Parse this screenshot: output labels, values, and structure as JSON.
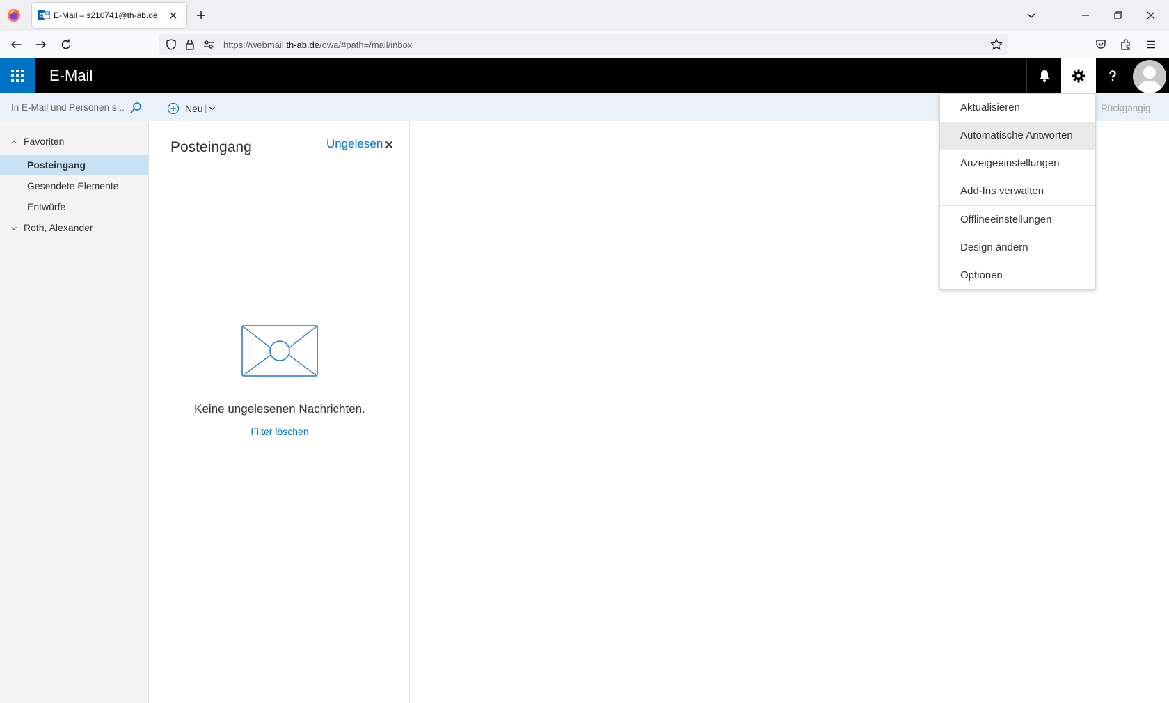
{
  "browser": {
    "tab_title": "E-Mail – s210741@th-ab.de",
    "url_prefix": "https://webmail.",
    "url_domain": "th-ab.de",
    "url_path": "/owa/#path=/mail/inbox"
  },
  "header": {
    "app_title": "E-Mail"
  },
  "search": {
    "placeholder": "In E-Mail und Personen s..."
  },
  "commands": {
    "new_label": "Neu",
    "undo_label": "Rückgängig"
  },
  "nav": {
    "favorites_label": "Favoriten",
    "items": [
      {
        "label": "Posteingang"
      },
      {
        "label": "Gesendete Elemente"
      },
      {
        "label": "Entwürfe"
      }
    ],
    "account_label": "Roth, Alexander"
  },
  "list": {
    "folder_title": "Posteingang",
    "filter_label": "Ungelesen",
    "empty_text": "Keine ungelesenen Nachrichten.",
    "clear_filter": "Filter löschen"
  },
  "settings_menu": {
    "items": [
      {
        "label": "Aktualisieren"
      },
      {
        "label": "Automatische Antworten"
      },
      {
        "label": "Anzeigeeinstellungen"
      },
      {
        "label": "Add-Ins verwalten"
      },
      {
        "label": "Offlineeinstellungen"
      },
      {
        "label": "Design ändern"
      },
      {
        "label": "Optionen"
      }
    ]
  },
  "colors": {
    "accent": "#0072c6",
    "header_bg": "#000000",
    "selected_bg": "#c7e0f4"
  }
}
